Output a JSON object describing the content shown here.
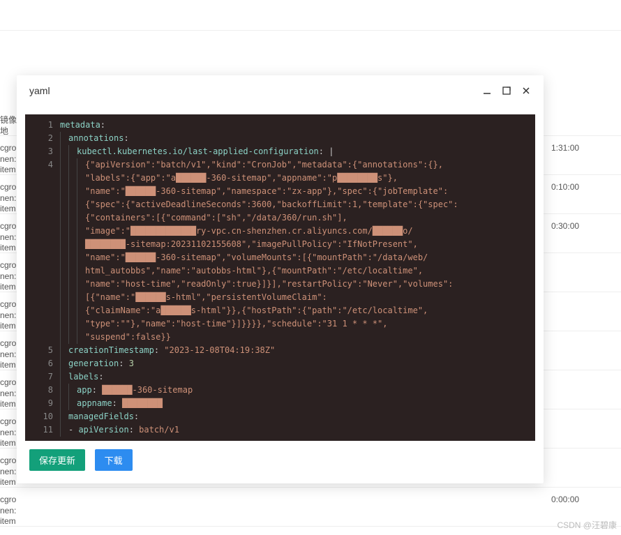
{
  "background": {
    "label_col": "镜像地",
    "rows": [
      {
        "c1": "cgro",
        "c2": "nen:",
        "c3": "item",
        "time": "1:31:00"
      },
      {
        "c1": "cgro",
        "c2": "nen:",
        "c3": "item",
        "time": "0:10:00"
      },
      {
        "c1": "cgro",
        "c2": "nen:",
        "c3": "item",
        "time": "0:30:00"
      },
      {
        "c1": "cgro",
        "c2": "nen:",
        "c3": "item",
        "time": ""
      },
      {
        "c1": "cgro",
        "c2": "nen:",
        "c3": "item",
        "time": ""
      },
      {
        "c1": "cgro",
        "c2": "nen:",
        "c3": "item",
        "time": ""
      },
      {
        "c1": "cgro",
        "c2": "nen:",
        "c3": "item",
        "time": ""
      },
      {
        "c1": "cgro",
        "c2": "nen:",
        "c3": "item",
        "time": ""
      },
      {
        "c1": "cgro",
        "c2": "nen:",
        "c3": "item",
        "time": ""
      },
      {
        "c1": "cgro",
        "c2": "nen:",
        "c3": "item",
        "time": "0:00:00"
      }
    ]
  },
  "modal": {
    "title": "yaml",
    "buttons": {
      "save": "保存更新",
      "download": "下载"
    },
    "icons": {
      "min": "minimize-icon",
      "expand": "expand-icon",
      "close": "close-icon"
    }
  },
  "code": {
    "lines": [
      {
        "n": 1,
        "indent": 0,
        "key": "metadata",
        "after": ":"
      },
      {
        "n": 2,
        "indent": 1,
        "key": "annotations",
        "after": ":"
      },
      {
        "n": 3,
        "indent": 2,
        "key": "kubectl.kubernetes.io/last-applied-configuration",
        "after": ": |"
      },
      {
        "n": 4,
        "indent": 3,
        "cont": [
          "{\"apiVersion\":\"batch/v1\",\"kind\":\"CronJob\",\"metadata\":{\"annotations\":{},",
          "\"labels\":{\"app\":\"a██████-360-sitemap\",\"appname\":\"p████████s\"},",
          "\"name\":\"██████-360-sitemap\",\"namespace\":\"zx-app\"},\"spec\":{\"jobTemplate\":",
          "{\"spec\":{\"activeDeadlineSeconds\":3600,\"backoffLimit\":1,\"template\":{\"spec\":",
          "{\"containers\":[{\"command\":[\"sh\",\"/data/360/run.sh\"],",
          "\"image\":\"█████████████ry-vpc.cn-shenzhen.cr.aliyuncs.com/██████o/",
          "████████-sitemap:20231102155608\",\"imagePullPolicy\":\"IfNotPresent\",",
          "\"name\":\"██████-360-sitemap\",\"volumeMounts\":[{\"mountPath\":\"/data/web/",
          "html_autobbs\",\"name\":\"autobbs-html\"},{\"mountPath\":\"/etc/localtime\",",
          "\"name\":\"host-time\",\"readOnly\":true}]}],\"restartPolicy\":\"Never\",\"volumes\":",
          "[{\"name\":\"██████s-html\",\"persistentVolumeClaim\":",
          "{\"claimName\":\"a██████s-html\"}},{\"hostPath\":{\"path\":\"/etc/localtime\",",
          "\"type\":\"\"},\"name\":\"host-time\"}]}}}},\"schedule\":\"31 1 * * *\",",
          "\"suspend\":false}}"
        ]
      },
      {
        "n": 5,
        "indent": 1,
        "key": "creationTimestamp",
        "after": ": ",
        "str": "\"2023-12-08T04:19:38Z\""
      },
      {
        "n": 6,
        "indent": 1,
        "key": "generation",
        "after": ": ",
        "num": "3"
      },
      {
        "n": 7,
        "indent": 1,
        "key": "labels",
        "after": ":"
      },
      {
        "n": 8,
        "indent": 2,
        "key": "app",
        "after": ": ",
        "str": "██████-360-sitemap"
      },
      {
        "n": 9,
        "indent": 2,
        "key": "appname",
        "after": ": ",
        "str": "████████"
      },
      {
        "n": 10,
        "indent": 1,
        "key": "managedFields",
        "after": ":"
      },
      {
        "n": 11,
        "indent": 1,
        "prefix": "- ",
        "key": "apiVersion",
        "after": ": ",
        "str": "batch/v1"
      }
    ]
  },
  "watermark": "CSDN @汪碧康"
}
